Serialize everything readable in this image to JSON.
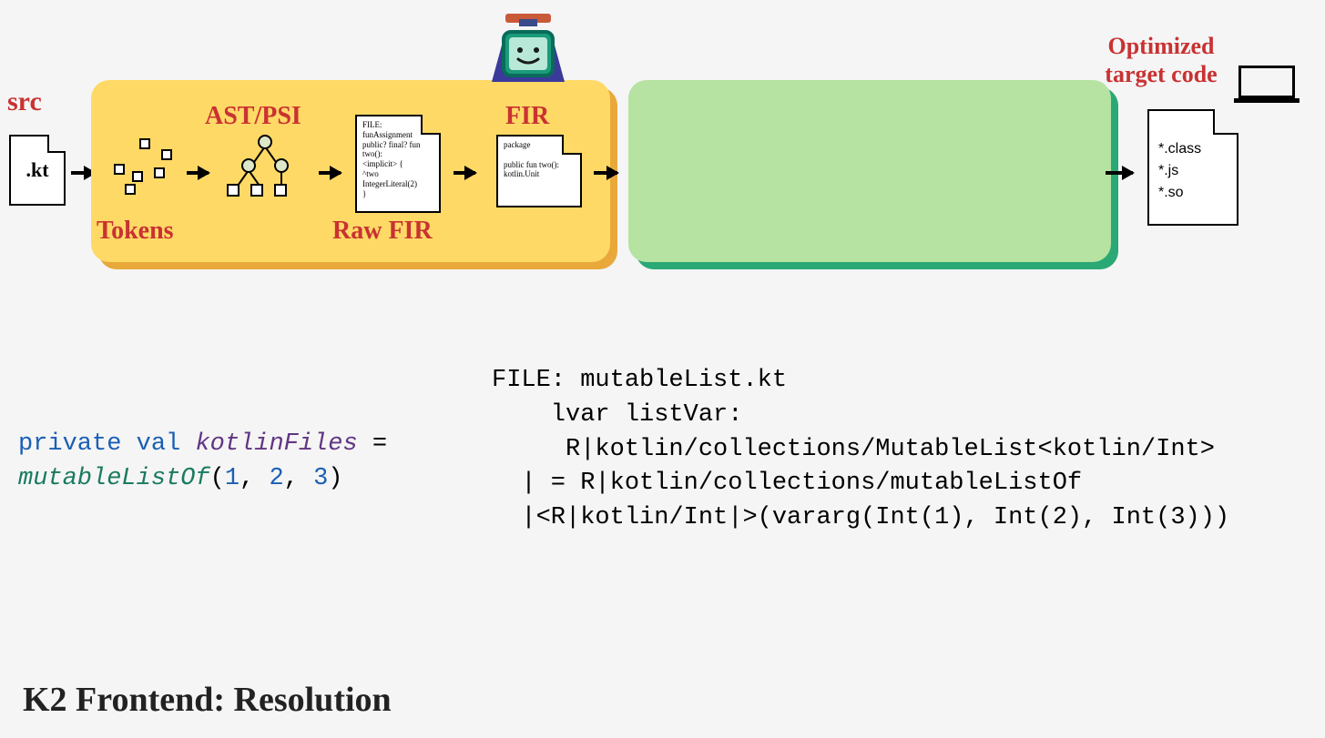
{
  "labels": {
    "src": "src",
    "srcFile": ".kt",
    "tokens": "Tokens",
    "astpsi": "AST/PSI",
    "rawfir": "Raw FIR",
    "fir": "FIR",
    "optTarget": "Optimized target code"
  },
  "rawFirDoc": "FILE:\nfunAssignment\n  public? final? fun\ntwo():\n<implicit> {\n    ^two\nIntegerLiteral(2)\n  }",
  "firDoc": "package\n\npublic fun two():\nkotlin.Unit",
  "outputs": [
    "*.class",
    "*.js",
    "*.so"
  ],
  "code": {
    "left": {
      "line1": {
        "kw1": "private",
        "kw2": "val",
        "ident": "kotlinFiles",
        "eq": " ="
      },
      "line2": {
        "func": "mutableListOf",
        "open": "(",
        "n1": "1",
        "c1": ", ",
        "n2": "2",
        "c2": ", ",
        "n3": "3",
        "close": ")"
      }
    },
    "right": "FILE: mutableList.kt\n    lvar listVar:\n     R|kotlin/collections/MutableList<kotlin/Int>\n  | = R|kotlin/collections/mutableListOf\n  |<R|kotlin/Int|>(vararg(Int(1), Int(2), Int(3)))"
  },
  "footer": "K2 Frontend: Resolution"
}
